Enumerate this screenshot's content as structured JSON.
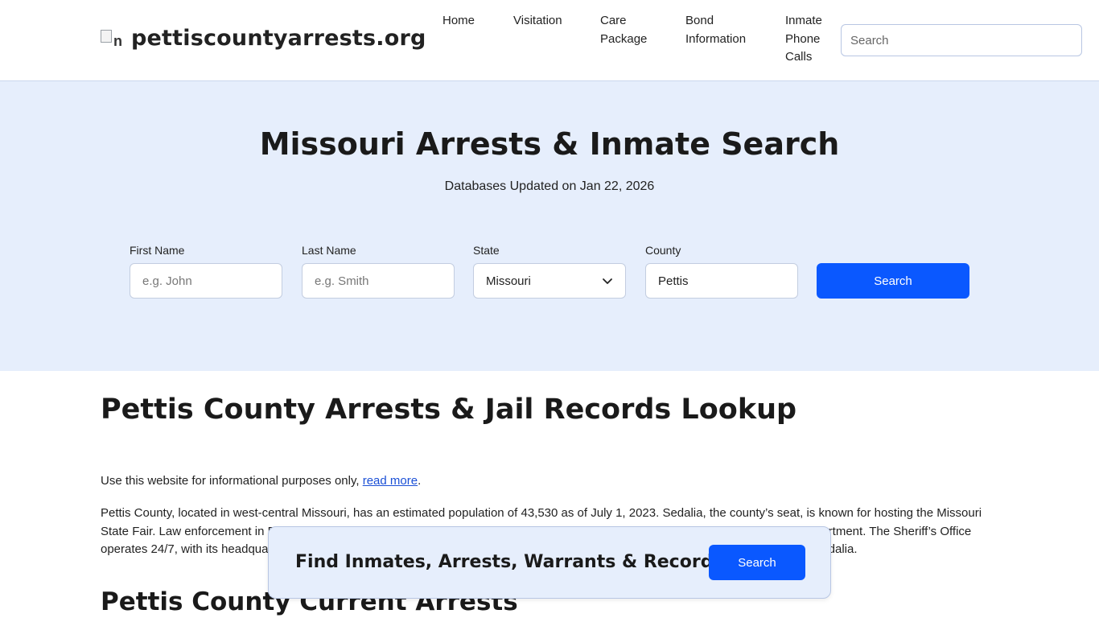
{
  "header": {
    "logo_alt": "n",
    "site_name": "pettiscountyarrests.org",
    "nav": [
      {
        "lines": [
          "Home"
        ]
      },
      {
        "lines": [
          "Visitation"
        ]
      },
      {
        "lines": [
          "Care",
          "Package"
        ]
      },
      {
        "lines": [
          "Bond",
          "Information"
        ]
      },
      {
        "lines": [
          "Inmate",
          "Phone",
          "Calls"
        ]
      }
    ],
    "search_placeholder": "Search"
  },
  "hero": {
    "title": "Missouri Arrests & Inmate Search",
    "subtitle": "Databases Updated on Jan 22, 2026",
    "fields": {
      "first_name_label": "First Name",
      "first_name_placeholder": "e.g. John",
      "last_name_label": "Last Name",
      "last_name_placeholder": "e.g. Smith",
      "state_label": "State",
      "state_value": "Missouri",
      "county_label": "County",
      "county_value": "Pettis"
    },
    "search_button": "Search"
  },
  "content": {
    "title": "Pettis County Arrests & Jail Records Lookup",
    "disclaimer_text": "Use this website for informational purposes only, ",
    "disclaimer_link": "read more",
    "disclaimer_end": ".",
    "paragraph": "Pettis County, located in west-central Missouri, has an estimated population of 43,530 as of July 1, 2023. Sedalia, the county’s seat, is known for hosting the Missouri State Fair. Law enforcement in Pettis County is managed by the Sheriff’s Office, led by Sheriff Brad Anders, and the Sedalia Police Department. The Sheriff’s Office operates 24/7, with its headquarters in Sedalia, while the Sedalia Police Department provides law enforcement within the city limits of Sedalia.",
    "section_title": "Pettis County Current Arrests"
  },
  "floating_banner": {
    "text": "Find Inmates, Arrests, Warrants & Records",
    "button": "Search"
  },
  "colors": {
    "accent": "#0a58ff",
    "hero_bg": "#e6eefc",
    "link": "#1a4fd6"
  }
}
